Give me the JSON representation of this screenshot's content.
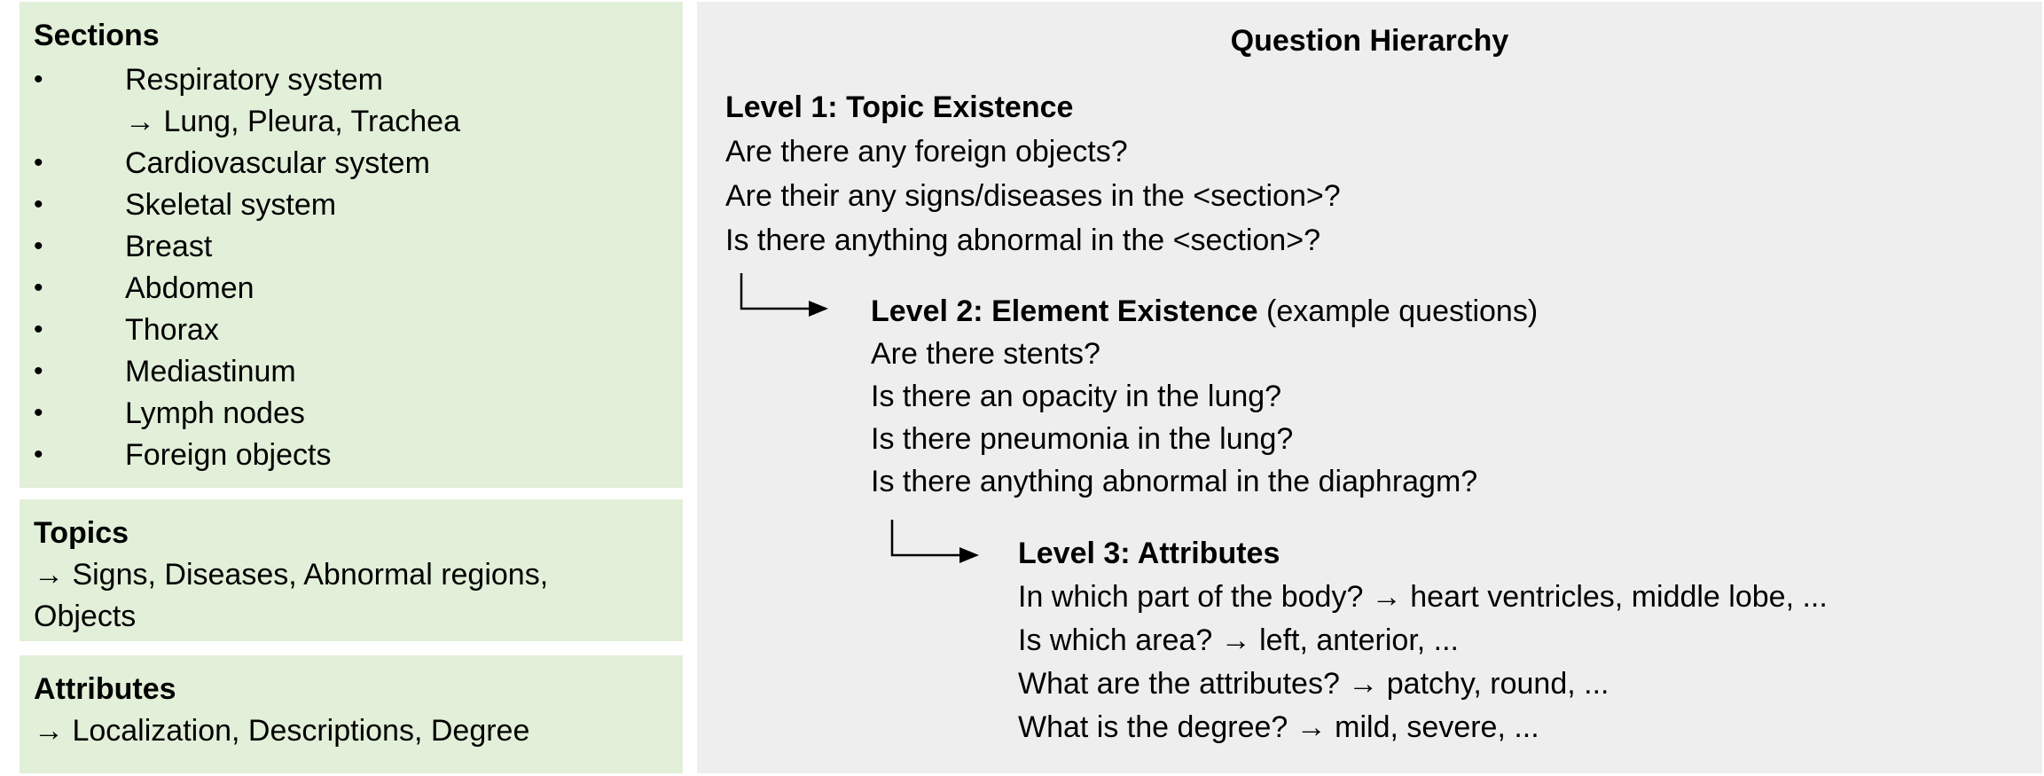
{
  "sections": {
    "title": "Sections",
    "bullet": "•",
    "items": [
      "Respiratory system",
      "→ Lung, Pleura, Trachea",
      "Cardiovascular system",
      "Skeletal system",
      "Breast",
      "Abdomen",
      "Thorax",
      "Mediastinum",
      "Lymph nodes",
      "Foreign objects"
    ]
  },
  "topics": {
    "title": "Topics",
    "line1": "→ Signs, Diseases, Abnormal regions,",
    "line2": "Objects"
  },
  "attributes": {
    "title": "Attributes",
    "line1": "→ Localization, Descriptions, Degree"
  },
  "hierarchy": {
    "title": "Question Hierarchy",
    "level1": {
      "heading": "Level 1: Topic Existence",
      "questions": [
        "Are there any foreign objects?",
        "Are their any signs/diseases in the <section>?",
        "Is there anything abnormal in the <section>?"
      ]
    },
    "level2": {
      "heading": "Level 2: Element Existence",
      "note": " (example questions)",
      "questions": [
        "Are there stents?",
        "Is there an opacity in the lung?",
        "Is there pneumonia in the lung?",
        "Is there anything abnormal in the diaphragm?"
      ]
    },
    "level3": {
      "heading": "Level 3: Attributes",
      "questions": [
        "In which part of the body? → heart ventricles, middle lobe, ...",
        "Is which area? → left, anterior, ...",
        "What are the attributes? → patchy, round, ...",
        "What is the degree? → mild, severe, ..."
      ]
    }
  },
  "colors": {
    "green_panel": "#e2efd9",
    "gray_panel": "#eeeeee"
  }
}
